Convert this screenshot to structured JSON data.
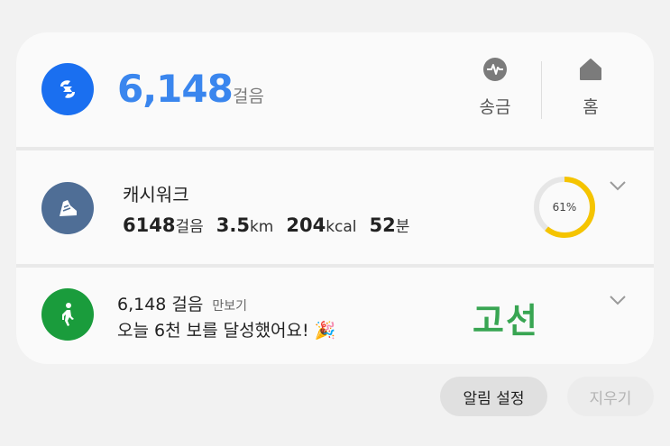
{
  "notification": {
    "steps_count": "6,148",
    "steps_unit": "걸음",
    "actions": [
      {
        "label": "송금",
        "icon": "pulse-coin-icon"
      },
      {
        "label": "홈",
        "icon": "home-icon"
      }
    ]
  },
  "cashwalk": {
    "title": "캐시워크",
    "steps": "6148",
    "steps_unit": "걸음",
    "distance": "3.5",
    "distance_unit": "km",
    "calories": "204",
    "calories_unit": "kcal",
    "minutes": "52",
    "minutes_unit": "분",
    "progress_label": "61%",
    "progress": 0.61,
    "colors": {
      "accent": "#f5c400",
      "icon_bg": "#4f6e96"
    }
  },
  "pedometer": {
    "steps_text": "6,148 걸음",
    "source": "만보기",
    "message": "오늘 6천 보를 달성했어요! 🎉",
    "stamp": "고선"
  },
  "footer": {
    "settings_label": "알림 설정",
    "clear_label": "지우기"
  }
}
